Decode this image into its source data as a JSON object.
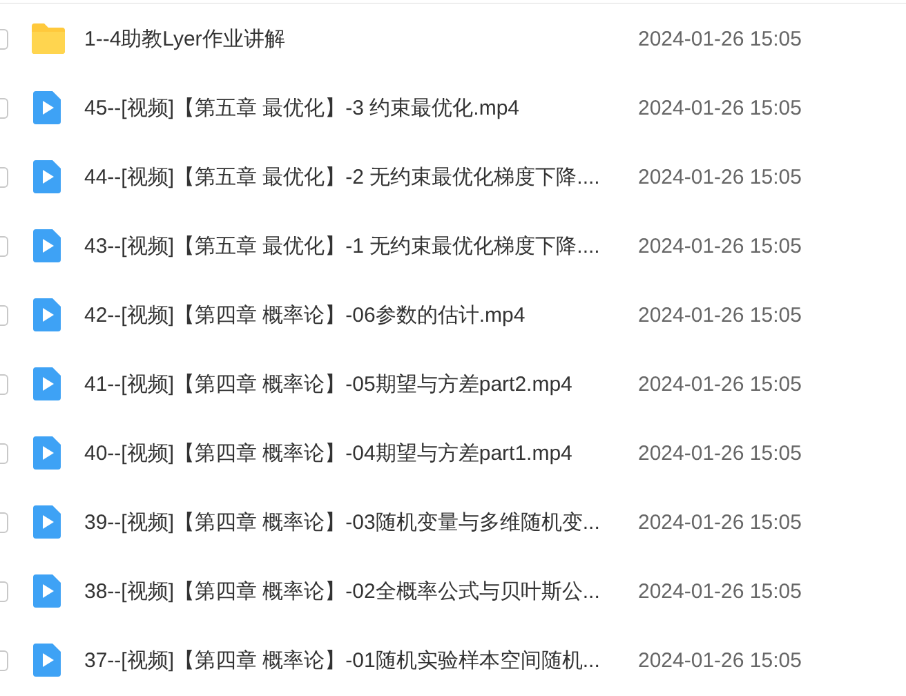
{
  "files": [
    {
      "kind": "folder",
      "name": "1--4助教Lyer作业讲解",
      "date": "2024-01-26 15:05",
      "checked": false
    },
    {
      "kind": "video",
      "name": "45--[视频]【第五章 最优化】-3 约束最优化.mp4",
      "date": "2024-01-26 15:05",
      "checked": false
    },
    {
      "kind": "video",
      "name": "44--[视频]【第五章 最优化】-2 无约束最优化梯度下降....",
      "date": "2024-01-26 15:05",
      "checked": false
    },
    {
      "kind": "video",
      "name": "43--[视频]【第五章 最优化】-1 无约束最优化梯度下降....",
      "date": "2024-01-26 15:05",
      "checked": false
    },
    {
      "kind": "video",
      "name": "42--[视频]【第四章 概率论】-06参数的估计.mp4",
      "date": "2024-01-26 15:05",
      "checked": false
    },
    {
      "kind": "video",
      "name": "41--[视频]【第四章 概率论】-05期望与方差part2.mp4",
      "date": "2024-01-26 15:05",
      "checked": false
    },
    {
      "kind": "video",
      "name": "40--[视频]【第四章 概率论】-04期望与方差part1.mp4",
      "date": "2024-01-26 15:05",
      "checked": false
    },
    {
      "kind": "video",
      "name": "39--[视频]【第四章 概率论】-03随机变量与多维随机变...",
      "date": "2024-01-26 15:05",
      "checked": false
    },
    {
      "kind": "video",
      "name": "38--[视频]【第四章 概率论】-02全概率公式与贝叶斯公...",
      "date": "2024-01-26 15:05",
      "checked": false
    },
    {
      "kind": "video",
      "name": "37--[视频]【第四章 概率论】-01随机实验样本空间随机...",
      "date": "2024-01-26 15:05",
      "checked": false
    }
  ]
}
